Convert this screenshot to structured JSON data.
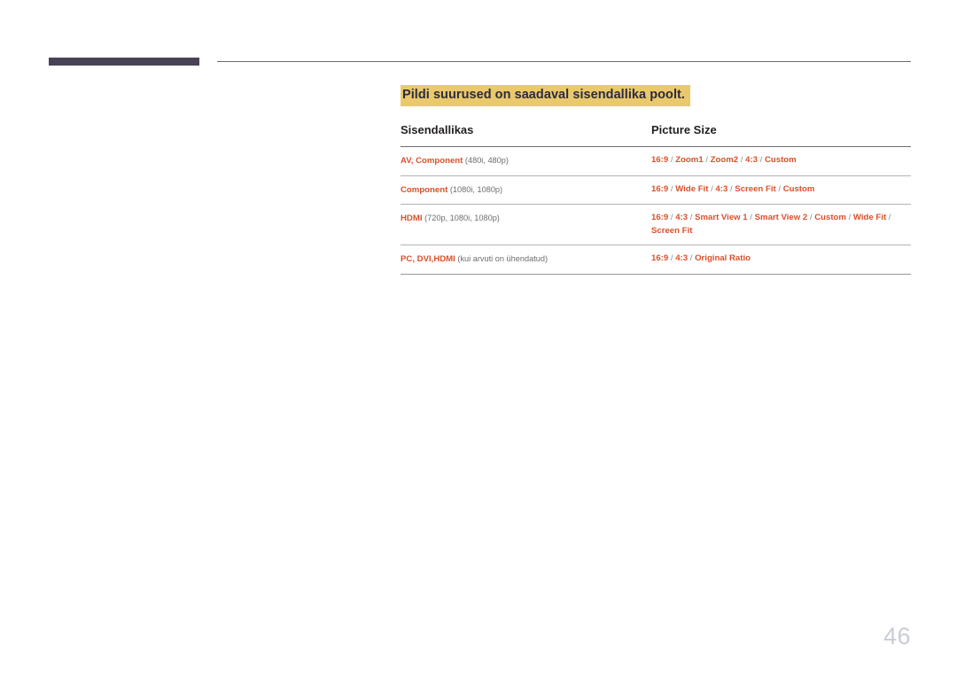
{
  "header": {
    "bar_color": "#4a4257",
    "rule_color": "#6f6a75"
  },
  "section": {
    "title": "Pildi suurused on saadaval sisendallika poolt.",
    "highlight_color": "#e9c96b",
    "title_color": "#2f2a3c"
  },
  "table": {
    "columns": [
      {
        "label": "Sisendallikas"
      },
      {
        "label": "Picture Size"
      }
    ],
    "accent_color": "#d9502a",
    "note_color": "#6d6e71",
    "separator_color": "#8b8b8b",
    "rows": [
      {
        "source_name": "AV, Component",
        "source_note": "(480i, 480p)",
        "options": [
          "16:9",
          "Zoom1",
          "Zoom2",
          "4:3",
          "Custom"
        ]
      },
      {
        "source_name": "Component",
        "source_note": "(1080i, 1080p)",
        "options": [
          "16:9",
          "Wide Fit",
          "4:3",
          "Screen Fit",
          "Custom"
        ]
      },
      {
        "source_name": "HDMI",
        "source_note": "(720p, 1080i, 1080p)",
        "options": [
          "16:9",
          "4:3",
          "Smart View 1",
          "Smart View 2",
          "Custom",
          "Wide Fit",
          "Screen Fit"
        ]
      },
      {
        "source_name": "PC, DVI,HDMI",
        "source_note": "(kui arvuti on ühendatud)",
        "options": [
          "16:9",
          "4:3",
          "Original Ratio"
        ]
      }
    ]
  },
  "footer": {
    "page_number": "46",
    "page_number_color": "#c9ccd6"
  }
}
